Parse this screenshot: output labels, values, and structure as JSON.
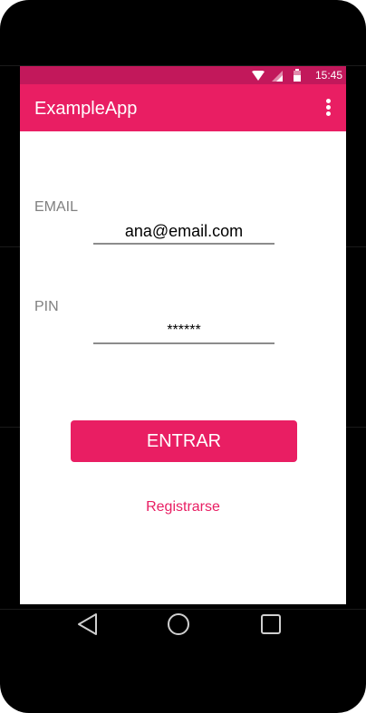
{
  "status_bar": {
    "time": "15:45",
    "background_color": "#c2185b",
    "icons": [
      "wifi-icon",
      "signal-icon",
      "battery-icon"
    ]
  },
  "app_bar": {
    "title": "ExampleApp",
    "background_color": "#e91e63",
    "menu_icon": "more-vert-icon"
  },
  "form": {
    "email": {
      "label": "EMAIL",
      "value": "ana@email.com"
    },
    "pin": {
      "label": "PIN",
      "value": "******"
    },
    "submit_label": "ENTRAR",
    "register_link": "Registrarse"
  },
  "nav_bar": {
    "buttons": [
      "back-icon",
      "home-icon",
      "recents-icon"
    ]
  },
  "colors": {
    "accent": "#e91e63",
    "status_dark": "#c2185b",
    "label_gray": "#808080"
  }
}
